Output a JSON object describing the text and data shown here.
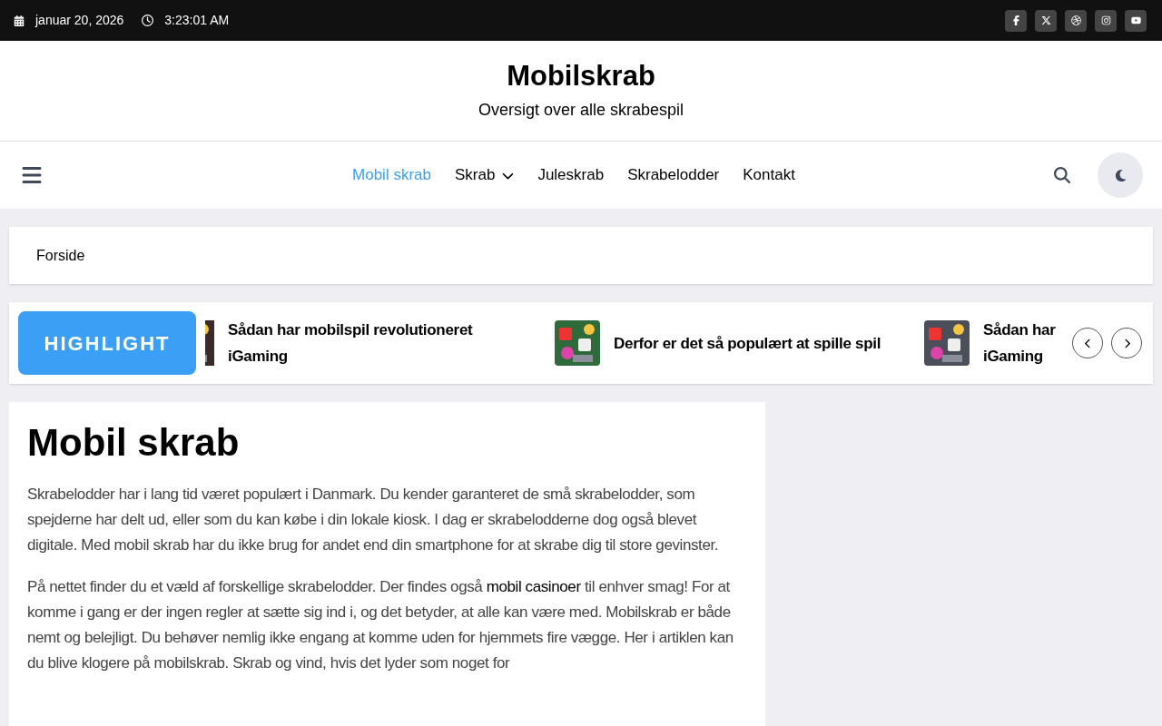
{
  "top_bar": {
    "date": "januar 20, 2026",
    "time": "3:23:01 AM",
    "social": [
      {
        "kind": "facebook"
      },
      {
        "kind": "x"
      },
      {
        "kind": "dribbble"
      },
      {
        "kind": "instagram"
      },
      {
        "kind": "youtube"
      }
    ]
  },
  "header": {
    "site_title": "Mobilskrab",
    "tagline": "Oversigt over alle skrabespil"
  },
  "nav": {
    "items": [
      {
        "label": "Mobil skrab",
        "selected": true,
        "has_submenu": false
      },
      {
        "label": "Skrab",
        "selected": false,
        "has_submenu": true
      },
      {
        "label": "Juleskrab",
        "selected": false,
        "has_submenu": false
      },
      {
        "label": "Skrabelodder",
        "selected": false,
        "has_submenu": false
      },
      {
        "label": "Kontakt",
        "selected": false,
        "has_submenu": false
      }
    ]
  },
  "breadcrumb": "Forside",
  "highlight": {
    "label": "HIGHLIGHT",
    "items": [
      {
        "title": "Sådan har mobilspil revolutioneret iGaming",
        "kind": "picture"
      },
      {
        "title": "Derfor er det så populært at spille spil",
        "kind": "picture"
      },
      {
        "title": "Sådan har iGaming",
        "kind": "picture"
      }
    ]
  },
  "article": {
    "title": "Mobil skrab",
    "paragraphs": [
      {
        "text": "Skrabelodder har i lang tid været populært i Danmark. Du kender garanteret de små skrabelodder, som spejderne har delt ud, eller som du kan købe i din lokale kiosk. I dag er skrabelodderne dog også blevet digitale. Med mobil skrab har du ikke brug for andet end din smartphone for at skrabe dig til store gevinster."
      },
      {
        "text": "På nettet finder du et væld af forskellige skrabelodder. Der findes også ",
        "link": "mobil casinoer",
        "text_after": " til enhver smag! For at komme i gang er der ingen regler at sætte sig ind i, og det betyder, at alle kan være med. Mobilskrab er både nemt og belejligt. Du behøver nemlig ikke engang at komme uden for hjemmets fire vægge. Her i artiklen kan du blive klogere på mobilskrab. Skrab og vind, hvis det lyder som noget for"
      }
    ]
  }
}
